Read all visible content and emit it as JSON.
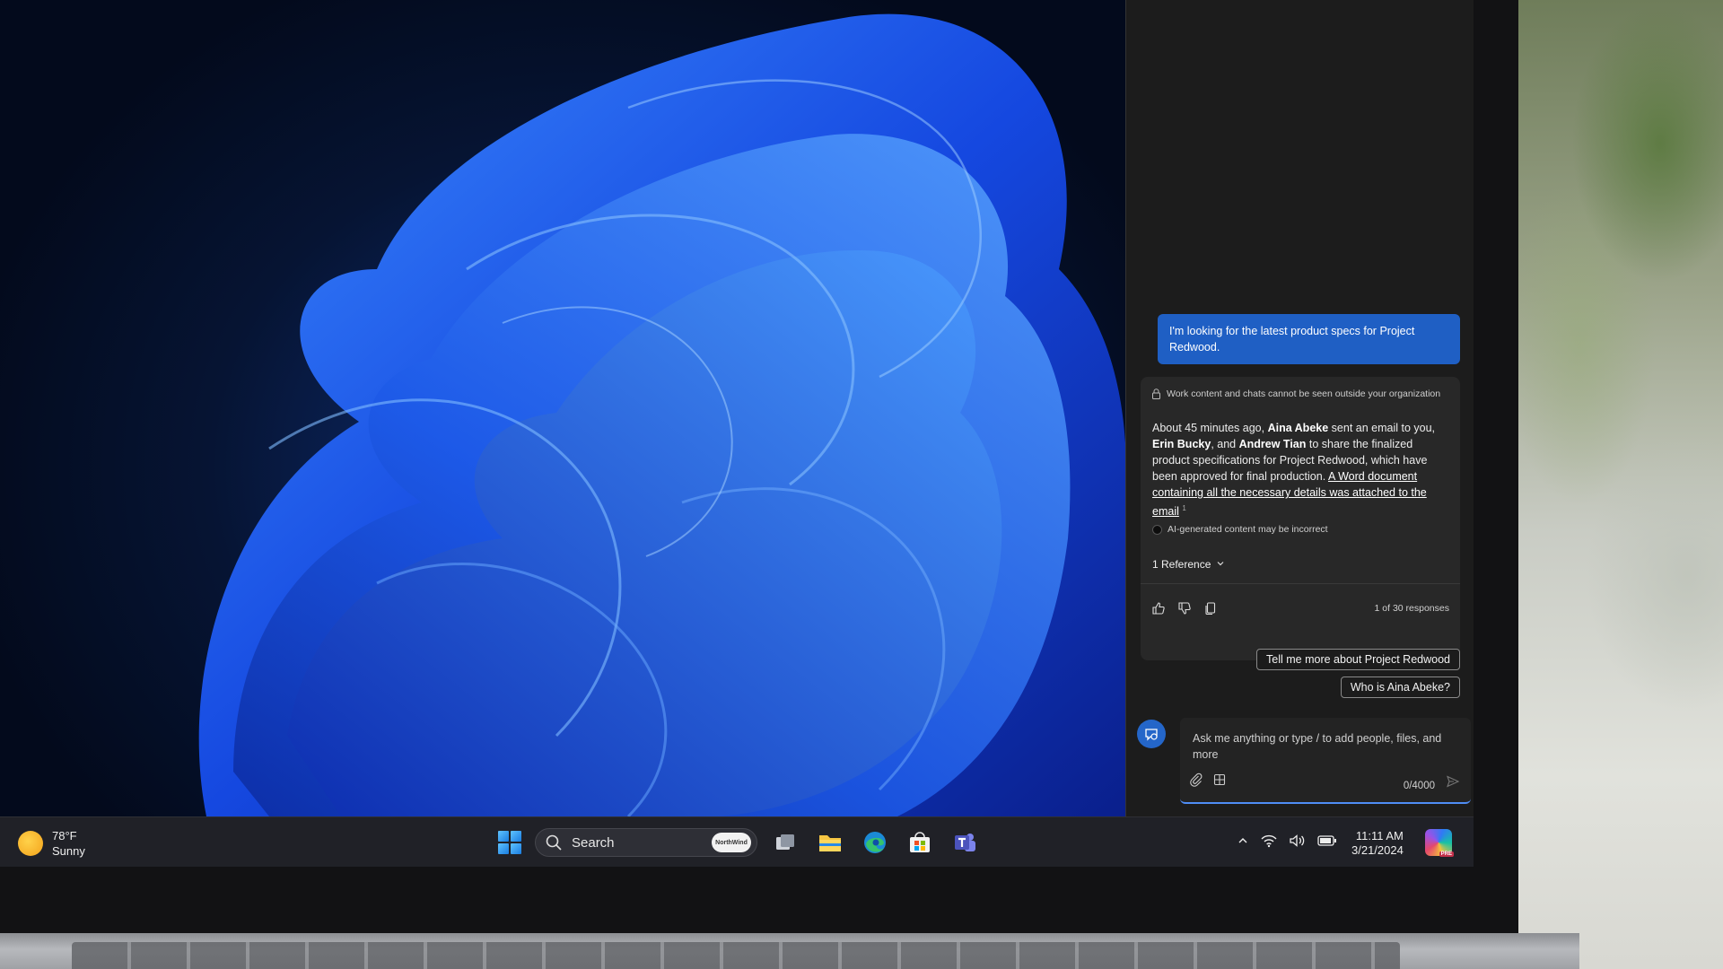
{
  "chat": {
    "user_prompt": "I'm looking for the latest product specs for Project Redwood.",
    "privacy_notice": "Work content and chats cannot be seen outside your organization",
    "response": {
      "p1": "About 45 minutes ago, ",
      "name1": "Aina Abeke",
      "p2": " sent an email to you, ",
      "name2": "Erin Bucky",
      "p3": ", and ",
      "name3": "Andrew Tian",
      "p4": " to share the finalized product specifications for Project Redwood, which have been approved for final production. ",
      "link": "A Word document containing all the necessary details was attached to the email",
      "citation": "1"
    },
    "ai_disclaimer": "AI-generated content may be incorrect",
    "references_label": "1 Reference",
    "response_count": "1 of 30 responses",
    "suggestions": [
      "Tell me more about Project Redwood",
      "Who is Aina Abeke?"
    ],
    "input_placeholder": "Ask me anything or type / to add people, files, and more",
    "char_counter": "0/4000"
  },
  "taskbar": {
    "weather_temp": "78°F",
    "weather_cond": "Sunny",
    "search_label": "Search",
    "search_badge": "NorthWind",
    "time": "11:11 AM",
    "date": "3/21/2024",
    "copilot_badge": "PRE"
  },
  "icons": {
    "start": "windows-start-icon",
    "search": "search-icon",
    "task_view": "task-view-icon",
    "explorer": "file-explorer-icon",
    "edge": "edge-icon",
    "store": "store-icon",
    "teams": "teams-icon",
    "tray_chevron": "chevron-up-icon",
    "wifi": "wifi-icon",
    "volume": "volume-icon",
    "battery": "battery-icon"
  },
  "colors": {
    "accent": "#1f5fc4",
    "pane_bg": "#1c1c1c",
    "taskbar_bg": "#202127"
  }
}
